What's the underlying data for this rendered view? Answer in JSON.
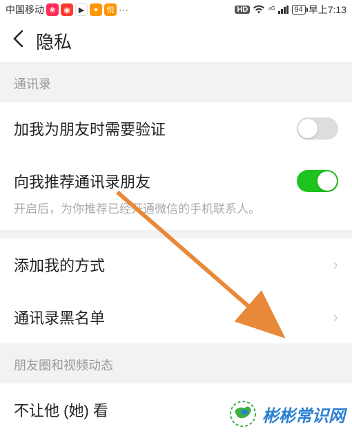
{
  "statusbar": {
    "carrier": "中国移动",
    "hd": "HD",
    "signal": "⁴ᴳ",
    "battery": "94",
    "time": "早上7:13"
  },
  "header": {
    "title": "隐私"
  },
  "sections": {
    "contacts": {
      "header": "通讯录",
      "verify": {
        "label": "加我为朋友时需要验证",
        "on": false
      },
      "recommend": {
        "label": "向我推荐通讯录朋友",
        "on": true,
        "desc": "开启后，为你推荐已经开通微信的手机联系人。"
      },
      "add_method": {
        "label": "添加我的方式"
      },
      "blacklist": {
        "label": "通讯录黑名单"
      }
    },
    "moments": {
      "header": "朋友圈和视频动态",
      "block": {
        "label": "不让他 (她) 看"
      }
    }
  },
  "watermark": {
    "text": "彬彬常识网"
  }
}
